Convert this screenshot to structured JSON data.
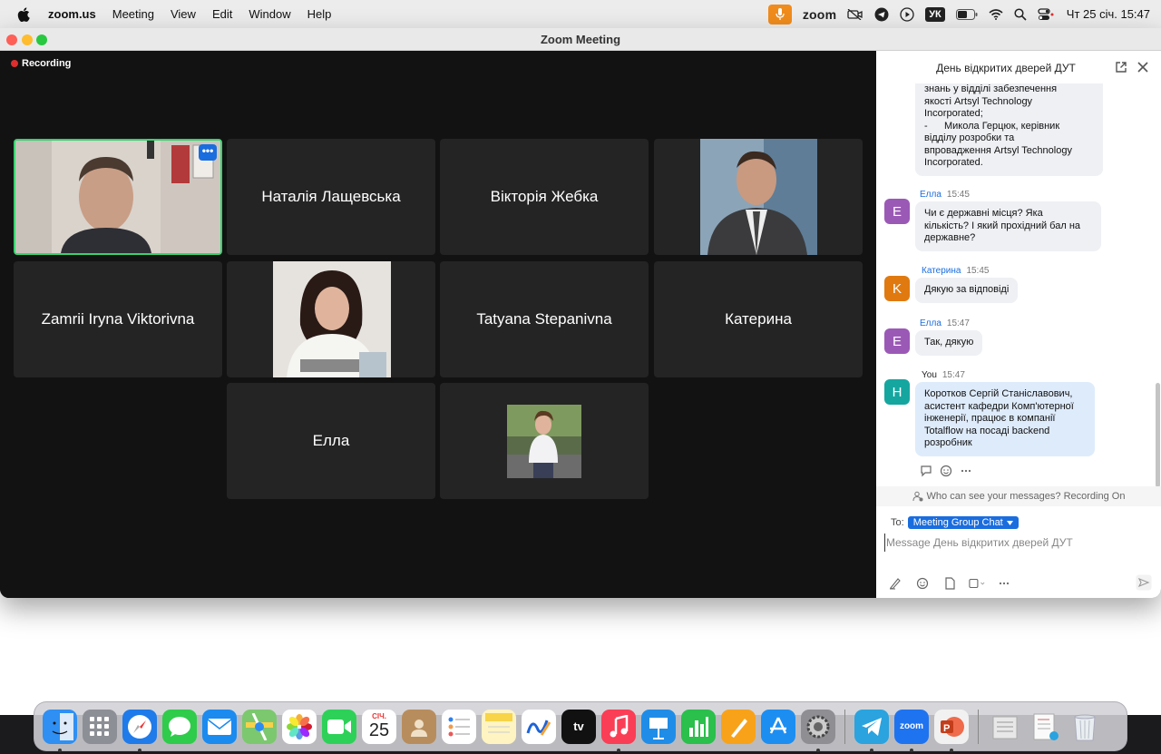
{
  "menubar": {
    "app_name": "zoom.us",
    "items": [
      "Meeting",
      "View",
      "Edit",
      "Window",
      "Help"
    ],
    "zoom_label": "zoom",
    "keyboard_layout": "УК",
    "clock": "Чт 25 січ.  15:47"
  },
  "window": {
    "title": "Zoom Meeting",
    "recording_label": "Recording"
  },
  "participants": [
    {
      "name": "",
      "video": true,
      "active_speaker": true
    },
    {
      "name": "Наталія Лащевська",
      "video": false
    },
    {
      "name": "Вікторія Жебка",
      "video": false
    },
    {
      "name": "",
      "video": true
    },
    {
      "name": "Zamrii Iryna Viktorivna",
      "video": false
    },
    {
      "name": "",
      "video": true
    },
    {
      "name": "Tatyana Stepanivna",
      "video": false
    },
    {
      "name": "Катерина",
      "video": false
    },
    {
      "name": "Елла",
      "video": false
    },
    {
      "name": "",
      "video": true
    }
  ],
  "chat": {
    "title": "День відкритих дверей ДУТ",
    "messages": [
      {
        "sender": "",
        "time": "",
        "text_lines": [
          "знань у відділі забезпечення",
          "якості Artsyl Technology",
          "Incorporated;",
          "-      Микола Герцюк, керівник",
          "відділу розробки та",
          "впровадження Artsyl Technology",
          "Incorporated."
        ]
      },
      {
        "sender": "Елла",
        "initial": "E",
        "time": "15:45",
        "text_lines": [
          "Чи є державні місця? Яка",
          "кількість? І який прохідний бал на",
          "державне?"
        ]
      },
      {
        "sender": "Катерина",
        "initial": "K",
        "time": "15:45",
        "text_lines": [
          "Дякую за відповіді"
        ]
      },
      {
        "sender": "Елла",
        "initial": "E",
        "time": "15:47",
        "text_lines": [
          "Так, дякую"
        ]
      },
      {
        "sender": "You",
        "initial": "H",
        "time": "15:47",
        "text_lines": [
          "Коротков Сергій Станіславович,",
          "асистент кафедри Комп'ютерної",
          "інженерії, працює в компанії",
          "Totalflow на посаді backend",
          "розробник"
        ]
      }
    ],
    "privacy_note": "Who can see your messages? Recording On",
    "to_label": "To:",
    "recipient": "Meeting Group Chat",
    "input_placeholder": "Message День відкритих дверей ДУТ"
  },
  "colors": {
    "active_speaker_border": "#3bd16f",
    "accent": "#1a6dde",
    "avatar_ella": "#9b59b6",
    "avatar_kateryna": "#e07a10",
    "avatar_you": "#15a6a0",
    "recording": "#e02d2d"
  },
  "dock": {
    "apps": [
      "finder-icon",
      "launchpad-icon",
      "safari-icon",
      "messages-icon",
      "mail-icon",
      "maps-icon",
      "photos-icon",
      "facetime-icon",
      "calendar-icon",
      "contacts-icon",
      "reminders-icon",
      "notes-icon",
      "freeform-icon",
      "apple-tv-icon",
      "music-icon",
      "keynote-icon",
      "numbers-icon",
      "pages-icon",
      "app-store-icon",
      "system-settings-icon",
      "telegram-icon",
      "zoom-icon",
      "powerpoint-icon",
      "downloads-icon",
      "documents-icon",
      "trash-icon"
    ],
    "calendar_month": "СІЧ.",
    "calendar_day": "25",
    "zoom_label": "zoom",
    "tv_label": "tv"
  }
}
